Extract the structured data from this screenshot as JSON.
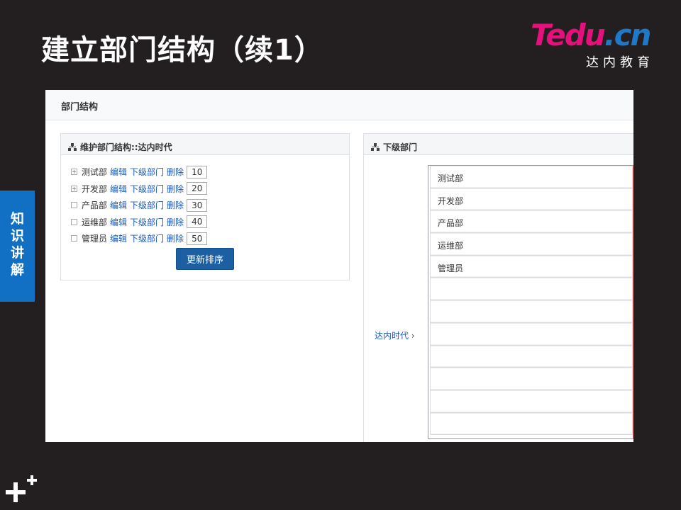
{
  "slide": {
    "title": "建立部门结构（续1）",
    "side_tab": [
      "知",
      "识",
      "讲",
      "解"
    ]
  },
  "logo": {
    "t": "T",
    "edu": "edu",
    "cn": ".cn",
    "sub": "达内教育"
  },
  "app": {
    "page_title": "部门结构",
    "left_panel_title": "维护部门结构::达内时代",
    "right_panel_title": "下级部门",
    "action_edit": "编辑",
    "action_sub": "下级部门",
    "action_delete": "删除",
    "update_button": "更新排序",
    "breadcrumb": "达内时代 ›",
    "departments": [
      {
        "name": "测试部",
        "order": "10",
        "toggle": "+"
      },
      {
        "name": "开发部",
        "order": "20",
        "toggle": "+"
      },
      {
        "name": "产品部",
        "order": "30",
        "toggle": ""
      },
      {
        "name": "运维部",
        "order": "40",
        "toggle": ""
      },
      {
        "name": "管理员",
        "order": "50",
        "toggle": ""
      }
    ],
    "sub_departments": [
      "测试部",
      "开发部",
      "产品部",
      "运维部",
      "管理员",
      "",
      "",
      "",
      "",
      "",
      "",
      ""
    ]
  },
  "colors": {
    "slide_bg": "#231f20",
    "side_tab": "#1170c4",
    "link": "#1a5bb8",
    "button": "#1d5fa3",
    "highlight_border": "#e57a7a"
  }
}
